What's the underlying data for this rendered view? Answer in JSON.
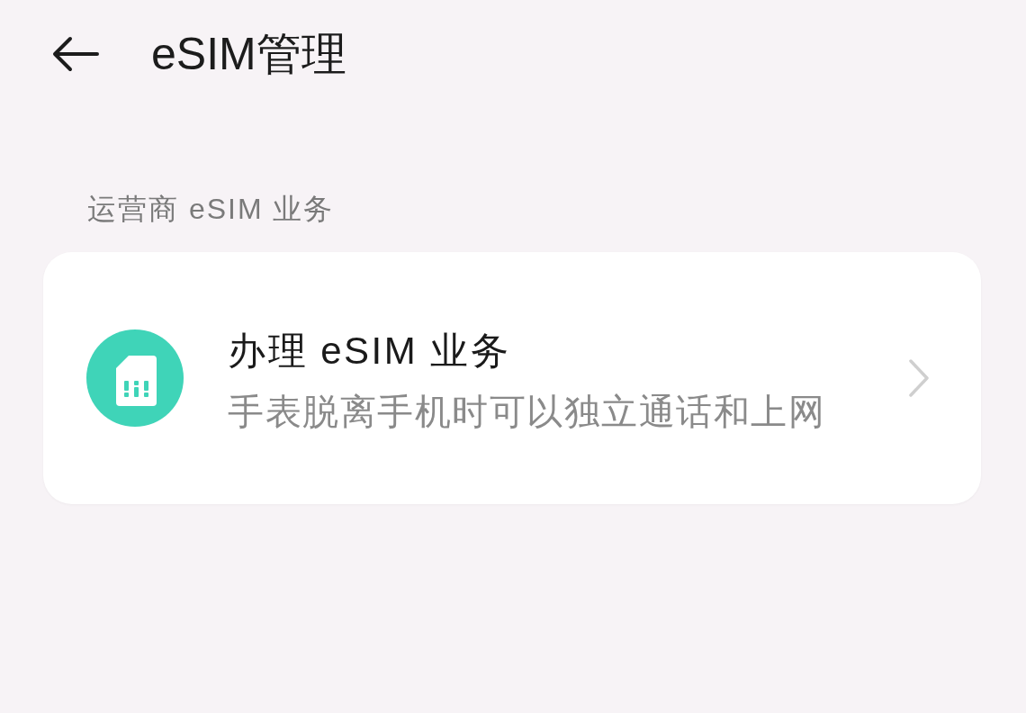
{
  "header": {
    "title": "eSIM管理"
  },
  "sections": [
    {
      "label": "运营商 eSIM 业务",
      "items": [
        {
          "title": "办理 eSIM 业务",
          "subtitle": "手表脱离手机时可以独立通话和上网"
        }
      ]
    }
  ]
}
